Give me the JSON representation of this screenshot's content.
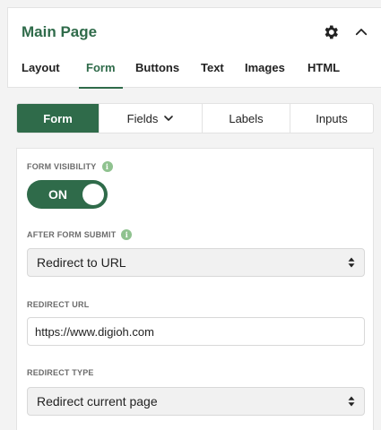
{
  "header": {
    "title": "Main Page",
    "settings_icon": "gear-icon",
    "collapse_icon": "chevron-up-icon"
  },
  "main_tabs": [
    {
      "label": "Layout",
      "active": false
    },
    {
      "label": "Form",
      "active": true
    },
    {
      "label": "Buttons",
      "active": false
    },
    {
      "label": "Text",
      "active": false
    },
    {
      "label": "Images",
      "active": false
    },
    {
      "label": "HTML",
      "active": false
    }
  ],
  "sub_tabs": [
    {
      "label": "Form",
      "active": true
    },
    {
      "label": "Fields",
      "active": false,
      "has_dropdown": true
    },
    {
      "label": "Labels",
      "active": false
    },
    {
      "label": "Inputs",
      "active": false
    }
  ],
  "form_visibility": {
    "label": "FORM VISIBILITY",
    "toggle_label": "ON",
    "toggle_on": true
  },
  "after_submit": {
    "label": "AFTER FORM SUBMIT",
    "selected": "Redirect to URL"
  },
  "redirect_url": {
    "label": "REDIRECT URL",
    "value": "https://www.digioh.com"
  },
  "redirect_type": {
    "label": "REDIRECT TYPE",
    "selected": "Redirect current page"
  },
  "colors": {
    "accent": "#2f6b4a",
    "info_badge": "#8fc28f"
  }
}
